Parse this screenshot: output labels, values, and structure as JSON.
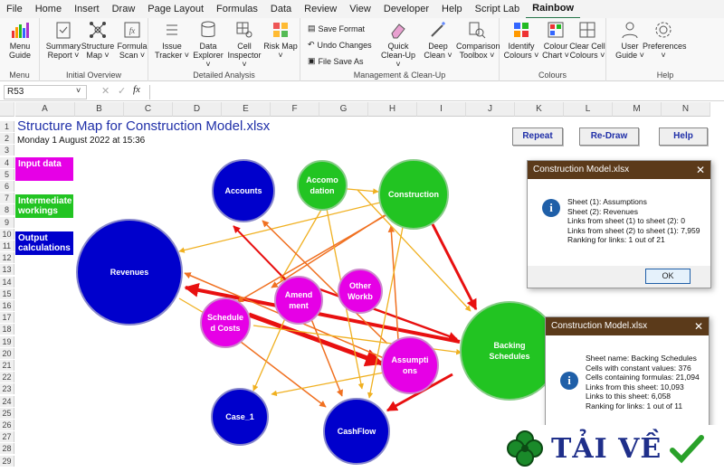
{
  "menu": {
    "tabs": [
      "File",
      "Home",
      "Insert",
      "Draw",
      "Page Layout",
      "Formulas",
      "Data",
      "Review",
      "View",
      "Developer",
      "Help",
      "Script Lab",
      "Rainbow"
    ],
    "active": "Rainbow"
  },
  "ribbon": {
    "groups": {
      "menu": "Menu",
      "initial": "Initial Overview",
      "detailed": "Detailed Analysis",
      "management": "Management & Clean-Up",
      "colours": "Colours",
      "help": "Help"
    },
    "buttons": {
      "menu_guide": "Menu Guide",
      "summary_report": "Summary Report ˅",
      "structure_map": "Structure Map ˅",
      "formula_scan": "Formula Scan ˅",
      "issue_tracker": "Issue Tracker ˅",
      "data_explorer": "Data Explorer ˅",
      "cell_inspector": "Cell Inspector ˅",
      "risk_map": "Risk Map ˅",
      "save_format": "Save Format",
      "undo_changes": "Undo Changes",
      "file_save_as": "File Save As",
      "quick_cleanup": "Quick Clean-Up ˅",
      "deep_clean": "Deep Clean ˅",
      "comparison_toolbox": "Comparison Toolbox ˅",
      "identify_colours": "Identify Colours ˅",
      "colour_chart": "Colour Chart ˅",
      "clear_cell_colours": "Clear Cell Colours ˅",
      "user_guide": "User Guide ˅",
      "preferences": "Preferences ˅"
    }
  },
  "formula_bar": {
    "cell_ref": "R53",
    "fx": "fx"
  },
  "columns": [
    "A",
    "B",
    "C",
    "D",
    "E",
    "F",
    "G",
    "H",
    "I",
    "J",
    "K",
    "L",
    "M",
    "N"
  ],
  "rows": [
    "1",
    "2",
    "3",
    "4",
    "5",
    "6",
    "7",
    "8",
    "9",
    "10",
    "11",
    "12",
    "13",
    "14",
    "15",
    "16",
    "17",
    "18",
    "19",
    "20",
    "21",
    "22",
    "23",
    "24",
    "25",
    "26",
    "27",
    "28",
    "29",
    "30"
  ],
  "sheet": {
    "title": "Structure Map for Construction Model.xlsx",
    "date": "Monday 1 August 2022 at 15:36",
    "legend": [
      {
        "label": "Input data",
        "color": "#e600e6"
      },
      {
        "label": "Intermediate workings",
        "color": "#22c422"
      },
      {
        "label": "Output calculations",
        "color": "#0000cc"
      }
    ],
    "buttons": {
      "repeat": "Repeat",
      "redraw": "Re-Draw",
      "help": "Help"
    }
  },
  "nodes": {
    "accounts": "Accounts",
    "accomodation": "Accomo dation",
    "construction": "Construction",
    "revenues": "Revenues",
    "other": "Other Workb",
    "amendment": "Amend ment",
    "scheduled": "Schedule d Costs",
    "backing": "Backing Schedules",
    "assumptions": "Assumpti ons",
    "case1": "Case_1",
    "cashflow": "CashFlow"
  },
  "dialog1": {
    "title": "Construction Model.xlsx",
    "lines": [
      "Sheet (1): Assumptions",
      "Sheet (2): Revenues",
      "Links from sheet (1) to sheet (2): 0",
      "Links from sheet (2) to sheet (1): 7,959",
      "Ranking for links: 1 out of 21"
    ],
    "ok": "OK"
  },
  "dialog2": {
    "title": "Construction Model.xlsx",
    "lines": [
      "Sheet name: Backing Schedules",
      "Cells with constant values: 376",
      "Cells containing formulas: 21,094",
      "Links from this sheet: 10,093",
      "Links to this sheet: 6,058",
      "Ranking for links: 1 out of 11"
    ]
  },
  "watermark": {
    "text": "TẢI VỀ"
  },
  "colors": {
    "input": "#e600e6",
    "intermediate": "#22c422",
    "output": "#0000cc",
    "accent": "#217346"
  }
}
